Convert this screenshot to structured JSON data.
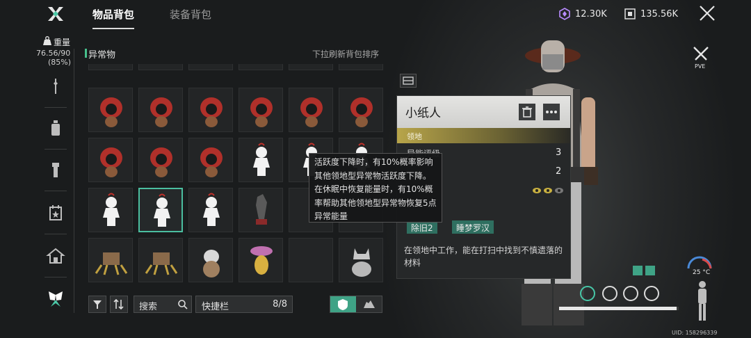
{
  "header": {
    "tabs": [
      {
        "label": "物品背包",
        "active": true
      },
      {
        "label": "装备背包",
        "active": false
      }
    ],
    "currency_1": {
      "icon": "crystal-hex-icon",
      "value": "12.30K",
      "color": "#b98cff"
    },
    "currency_2": {
      "icon": "chip-icon",
      "value": "135.56K"
    }
  },
  "sidebar": {
    "weight_label": "重量",
    "weight_value": "76.56/90",
    "weight_percent": "(85%)",
    "categories": [
      "wrench-icon",
      "bottle-icon",
      "flashlight-icon",
      "calendar-icon",
      "house-icon",
      "butterfly-icon"
    ]
  },
  "inventory": {
    "section_title": "异常物",
    "refresh_hint": "下拉刷新背包排序",
    "search_label": "搜索",
    "quickbar_label": "快捷栏",
    "quickbar_count": "8/8",
    "accent": "#46c08c"
  },
  "detail": {
    "name": "小纸人",
    "tag": "领地",
    "stats": [
      {
        "label": "异能评级",
        "value": "3"
      },
      {
        "label": "",
        "value": "2"
      }
    ],
    "traits": [
      "除旧2",
      "睡梦罗汉"
    ],
    "description": "在领地中工作，能在打扫中找到不慎遗落的材料"
  },
  "tooltip": {
    "text": "活跃度下降时，有10%概率影响其他领地型异常物活跃度下降。在休眠中恢复能量时，有10%概率帮助其他领地型异常物恢复5点异常能量"
  },
  "hud": {
    "pve_label": "PVE",
    "temperature": "25 °C",
    "uid": "UID: 158296339",
    "health_fraction": 0.98
  }
}
